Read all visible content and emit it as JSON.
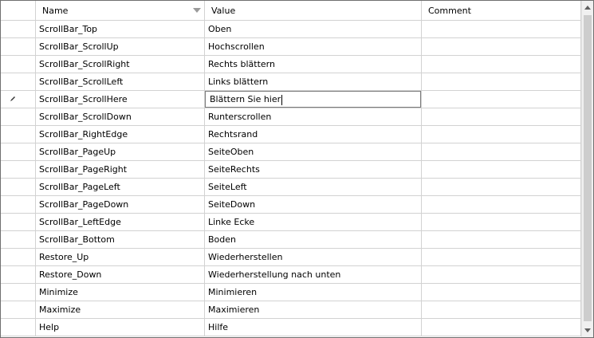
{
  "header": {
    "name": "Name",
    "value": "Value",
    "comment": "Comment"
  },
  "editing_row_index": 4,
  "rows": [
    {
      "name": "ScrollBar_Top",
      "value": "Oben",
      "comment": ""
    },
    {
      "name": "ScrollBar_ScrollUp",
      "value": "Hochscrollen",
      "comment": ""
    },
    {
      "name": "ScrollBar_ScrollRight",
      "value": "Rechts blättern",
      "comment": ""
    },
    {
      "name": "ScrollBar_ScrollLeft",
      "value": "Links blättern",
      "comment": ""
    },
    {
      "name": "ScrollBar_ScrollHere",
      "value": "Blättern Sie hier",
      "comment": ""
    },
    {
      "name": "ScrollBar_ScrollDown",
      "value": "Runterscrollen",
      "comment": ""
    },
    {
      "name": "ScrollBar_RightEdge",
      "value": "Rechtsrand",
      "comment": ""
    },
    {
      "name": "ScrollBar_PageUp",
      "value": "SeiteOben",
      "comment": ""
    },
    {
      "name": "ScrollBar_PageRight",
      "value": "SeiteRechts",
      "comment": ""
    },
    {
      "name": "ScrollBar_PageLeft",
      "value": "SeiteLeft",
      "comment": ""
    },
    {
      "name": "ScrollBar_PageDown",
      "value": "SeiteDown",
      "comment": ""
    },
    {
      "name": "ScrollBar_LeftEdge",
      "value": "Linke Ecke",
      "comment": ""
    },
    {
      "name": "ScrollBar_Bottom",
      "value": "Boden",
      "comment": ""
    },
    {
      "name": "Restore_Up",
      "value": "Wiederherstellen",
      "comment": ""
    },
    {
      "name": "Restore_Down",
      "value": "Wiederherstellung nach unten",
      "comment": ""
    },
    {
      "name": "Minimize",
      "value": "Minimieren",
      "comment": ""
    },
    {
      "name": "Maximize",
      "value": "Maximieren",
      "comment": ""
    },
    {
      "name": "Help",
      "value": "Hilfe",
      "comment": ""
    }
  ],
  "icons": {
    "sort": "chevron-down-icon",
    "edit": "pencil-icon",
    "scroll_up": "arrow-up-icon",
    "scroll_down": "arrow-down-icon"
  }
}
